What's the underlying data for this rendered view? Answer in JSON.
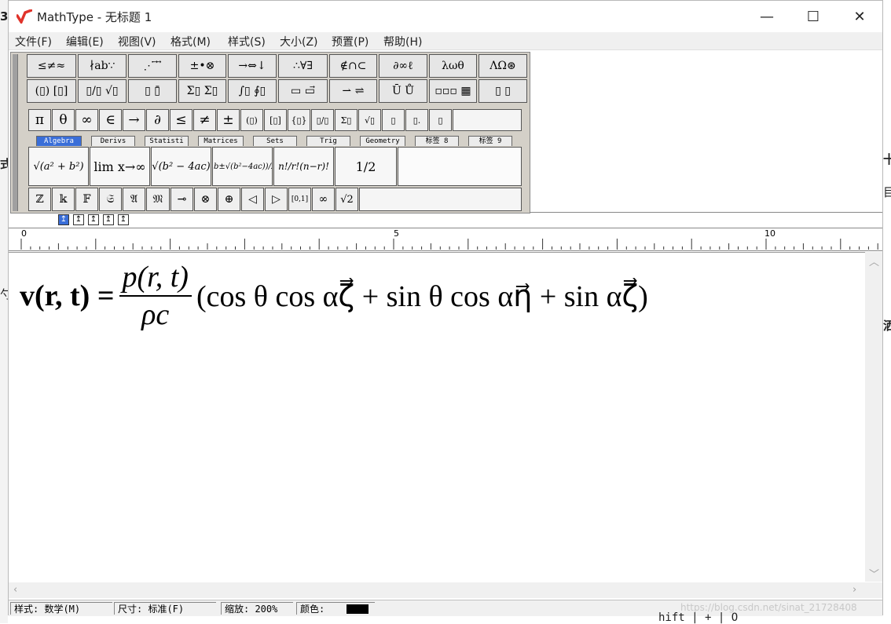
{
  "window": {
    "title": "MathType - 无标题 1",
    "minimize_glyph": "—",
    "maximize_glyph": "☐",
    "close_glyph": "✕",
    "accent": "#e0332a"
  },
  "menu": [
    "文件(F)",
    "编辑(E)",
    "视图(V)",
    "格式(M)",
    "样式(S)",
    "大小(Z)",
    "预置(P)",
    "帮助(H)"
  ],
  "symbol_row1": [
    "≤≠≈",
    "∤ab∵",
    "⋰ ⃗ ⃗",
    "±•⊗",
    "→⇔↓",
    "∴∀∃",
    "∉∩⊂",
    "∂∞ℓ",
    "λωθ",
    "ΛΩ⊛"
  ],
  "symbol_row2": [
    "(▯) [▯]",
    "▯/▯ √▯",
    "▯ ▯̄",
    "Σ▯ Σ▯",
    "∫▯ ∮▯",
    "▭ ▭⃗",
    "⇀ ⇌",
    "Ū Ů",
    "▫▫▫ ▦",
    "▯ ▯"
  ],
  "small_symbols": [
    "π",
    "θ",
    "∞",
    "∈",
    "→",
    "∂",
    "≤",
    "≠",
    "±",
    "(▯)",
    "[▯]",
    "{▯}",
    "▯/▯",
    "Σ▯",
    "√▯",
    "▯",
    "▯.",
    "▯"
  ],
  "tabs": [
    "Algebra",
    "Derivs",
    "Statisti",
    "Matrices",
    "Sets",
    "Trig",
    "Geometry",
    "标签 8",
    "标签 9"
  ],
  "templates": [
    "√(a² + b²)",
    "lim x→∞",
    "√(b² − 4ac)",
    "(−b±√(b²−4ac))/2a",
    "n!/r!(n−r)!",
    "1/2"
  ],
  "small_bottom": [
    "ℤ",
    "𝕜",
    "𝔽",
    "𝔖",
    "𝔄",
    "𝔐",
    "⊸",
    "⊗",
    "⊕",
    "◁",
    "▷",
    "[0,1]",
    "∞",
    "√2"
  ],
  "nudge_buttons": [
    "↥",
    "↥",
    "↥",
    "↥",
    "↥"
  ],
  "ruler": {
    "labels": [
      "0",
      "5",
      "10"
    ]
  },
  "equation": {
    "lhs": "v(r, t) =",
    "numerator": "p(r, t)",
    "denominator": "ρc",
    "rhs": "(cos θ cos αζ⃗ + sin θ cos αη⃗ + sin αζ⃗)"
  },
  "status": {
    "style": "样式: 数学(M)",
    "size": "尺寸: 标准(F)",
    "zoom": "缩放: 200%",
    "color_label": "颜色:",
    "color_value": "#000000"
  },
  "watermark": "https://blog.csdn.net/sinat_21728408",
  "behind_text": "hift | + | O",
  "bg_fragments": [
    "3",
    "式",
    "勺",
    "十",
    "目",
    "洒"
  ]
}
